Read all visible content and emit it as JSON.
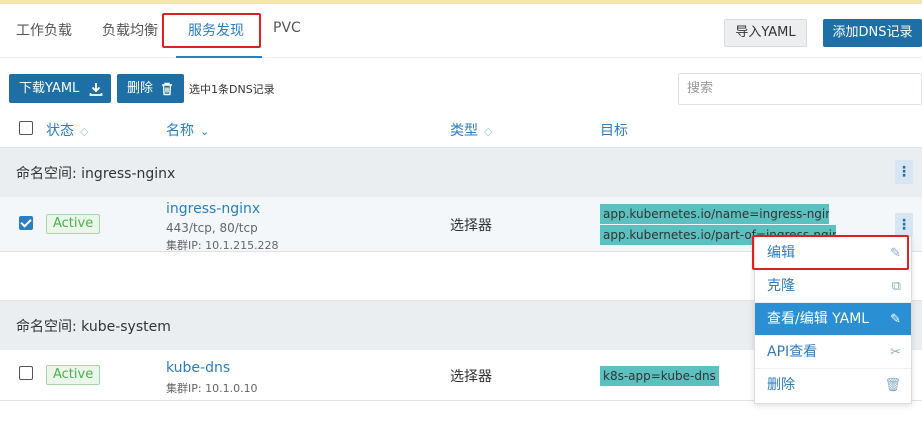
{
  "tabs": [
    {
      "label": "工作负载"
    },
    {
      "label": "负载均衡"
    },
    {
      "label": "服务发现"
    },
    {
      "label": "PVC"
    }
  ],
  "header_buttons": {
    "import_yaml": "导入YAML",
    "add_dns": "添加DNS记录"
  },
  "toolbar": {
    "download_yaml": "下载YAML",
    "delete": "删除",
    "selected_text": "选中1条DNS记录",
    "search_placeholder": "搜索"
  },
  "columns": {
    "state": "状态",
    "name": "名称",
    "type": "类型",
    "target": "目标"
  },
  "namespaces": [
    {
      "label": "命名空间: ingress-nginx",
      "rows": [
        {
          "state": "Active",
          "name": "ingress-nginx",
          "ports": "443/tcp, 80/tcp",
          "cluster_ip": "集群IP: 10.1.215.228",
          "type": "选择器",
          "targets": [
            "app.kubernetes.io/name=ingress-nginx",
            "app.kubernetes.io/part-of=ingress-nginx"
          ],
          "checked": true
        }
      ]
    },
    {
      "label": "命名空间: kube-system",
      "rows": [
        {
          "state": "Active",
          "name": "kube-dns",
          "cluster_ip": "集群IP: 10.1.0.10",
          "type": "选择器",
          "targets": [
            "k8s-app=kube-dns"
          ],
          "checked": false
        }
      ]
    }
  ],
  "context_menu": {
    "items": [
      {
        "label": "编辑",
        "icon": "pencil-icon"
      },
      {
        "label": "克隆",
        "icon": "copy-icon"
      },
      {
        "label": "查看/编辑 YAML",
        "icon": "pencil-icon"
      },
      {
        "label": "API查看",
        "icon": "tools-icon"
      },
      {
        "label": "删除",
        "icon": "trash-icon"
      }
    ]
  },
  "colors": {
    "accent": "#2b7ec1",
    "primary_button": "#1d6fa5",
    "highlight": "#e02020",
    "tag": "#5bc0c0"
  }
}
